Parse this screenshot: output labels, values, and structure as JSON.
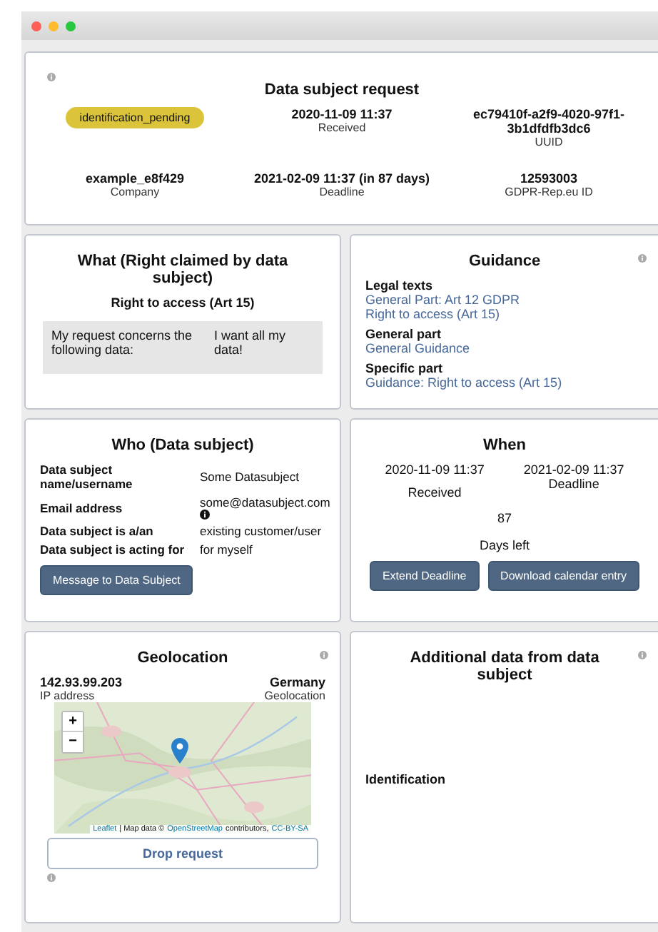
{
  "request": {
    "title": "Data subject request",
    "status": "identification_pending",
    "fields": [
      {
        "value": "2020-11-09 11:37",
        "label": "Received"
      },
      {
        "value": "ec79410f-a2f9-4020-97f1-3b1dfdfb3dc6",
        "label": "UUID"
      },
      {
        "value": "example_e8f429",
        "label": "Company"
      },
      {
        "value": "2021-02-09 11:37 (in 87 days)",
        "label": "Deadline"
      },
      {
        "value": "12593003",
        "label": "GDPR-Rep.eu ID"
      }
    ]
  },
  "what": {
    "title": "What (Right claimed by data subject)",
    "right": "Right to access (Art 15)",
    "question": "My request concerns the following data:",
    "answer": "I want all my data!"
  },
  "guidance": {
    "title": "Guidance",
    "sections": [
      {
        "heading": "Legal texts",
        "links": [
          "General Part: Art 12 GDPR",
          "Right to access (Art 15)"
        ]
      },
      {
        "heading": "General part",
        "links": [
          "General Guidance"
        ]
      },
      {
        "heading": "Specific part",
        "links": [
          "Guidance: Right to access (Art 15)"
        ]
      }
    ]
  },
  "who": {
    "title": "Who (Data subject)",
    "rows": [
      {
        "label": "Data subject name/username",
        "value": "Some Datasubject",
        "info": false
      },
      {
        "label": "Email address",
        "value": "some@datasubject.com",
        "info": true
      },
      {
        "label": "Data subject is a/an",
        "value": "existing customer/user",
        "info": false
      },
      {
        "label": "Data subject is acting for",
        "value": "for myself",
        "info": false
      }
    ],
    "button": "Message to Data Subject"
  },
  "when": {
    "title": "When",
    "received": "2020-11-09 11:37",
    "received_label": "Received",
    "deadline": "2021-02-09 11:37",
    "deadline_label": "Deadline",
    "days": "87",
    "days_label": "Days left",
    "buttons": [
      "Extend Deadline",
      "Download calendar entry"
    ]
  },
  "geolocation": {
    "title": "Geolocation",
    "ip": "142.93.99.203",
    "ip_label": "IP address",
    "country": "Germany",
    "country_label": "Geolocation",
    "map": {
      "kind": "picture",
      "zoom_in": "+",
      "zoom_out": "−",
      "attribution": [
        "Leaflet",
        "| Map data ©",
        "OpenStreetMap",
        "contributors,",
        "CC-BY-SA"
      ]
    },
    "button": "Drop request"
  },
  "additional": {
    "title": "Additional data from data subject",
    "label": "Identification"
  }
}
